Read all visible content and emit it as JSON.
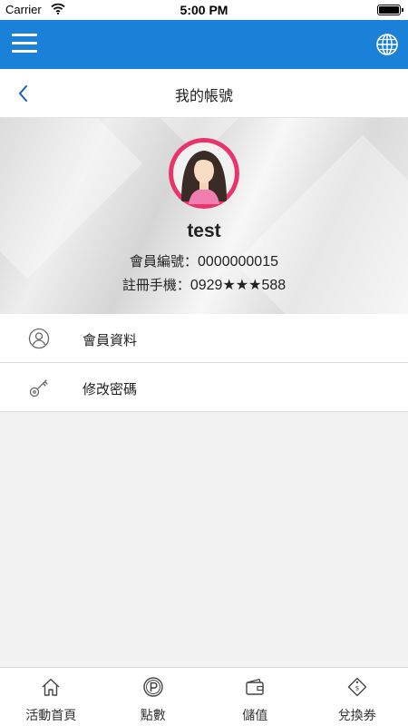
{
  "status_bar": {
    "carrier": "Carrier",
    "time": "5:00 PM"
  },
  "header": {
    "title": "我的帳號"
  },
  "profile": {
    "name": "test",
    "member_no_label": "會員編號：",
    "member_no": "0000000015",
    "phone_label": "註冊手機：",
    "phone": "0929★★★588"
  },
  "menu": [
    {
      "label": "會員資料",
      "icon": "user-icon"
    },
    {
      "label": "修改密碼",
      "icon": "key-icon"
    }
  ],
  "tabs": [
    {
      "label": "活動首頁",
      "icon": "home-icon"
    },
    {
      "label": "點數",
      "icon": "points-icon"
    },
    {
      "label": "儲值",
      "icon": "wallet-icon"
    },
    {
      "label": "兌換券",
      "icon": "coupon-icon"
    }
  ],
  "colors": {
    "primary": "#1a80d8",
    "avatar_ring": "#e8336b",
    "background": "#f2f2f2"
  }
}
